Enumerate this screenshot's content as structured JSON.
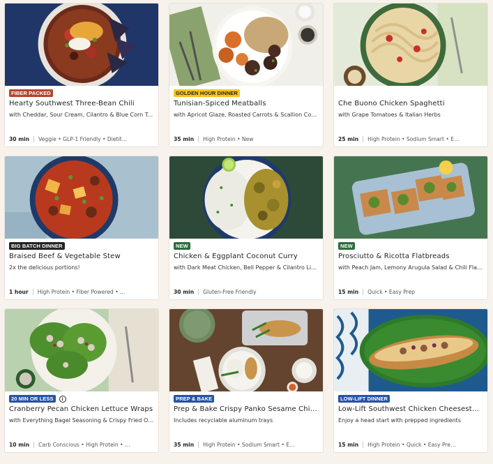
{
  "tag_colors": {
    "fiber_packed": {
      "bg": "#b5452d",
      "fg": "#ffffff"
    },
    "golden_hour": {
      "bg": "#f5c51a",
      "fg": "#242424"
    },
    "big_batch": {
      "bg": "#242424",
      "fg": "#ffffff"
    },
    "new": {
      "bg": "#2e6b3e",
      "fg": "#ffffff"
    },
    "twenty_min": {
      "bg": "#2553a6",
      "fg": "#ffffff"
    },
    "prep_bake": {
      "bg": "#2553a6",
      "fg": "#ffffff"
    },
    "low_lift": {
      "bg": "#2553a6",
      "fg": "#ffffff"
    }
  },
  "recipes": [
    {
      "tag": "FIBER PACKED",
      "title": "Hearty Southwest Three-Bean Chili",
      "subtitle": "with Cheddar, Sour Cream, Cilantro & Blue Corn Tor…",
      "time": "30 min",
      "attributes": "Veggie • GLP-1 Friendly • Dietit…",
      "image": "chili-bowl-image"
    },
    {
      "tag": "GOLDEN HOUR DINNER",
      "title": "Tunisian-Spiced Meatballs",
      "subtitle": "with Apricot Glaze, Roasted Carrots & Scallion Cous…",
      "time": "35 min",
      "attributes": "High Protein • New",
      "image": "meatballs-plate-image"
    },
    {
      "tag": "",
      "title": "Che Buono Chicken Spaghetti",
      "subtitle": "with Grape Tomatoes & Italian Herbs",
      "time": "25 min",
      "attributes": "High Protein • Sodium Smart • E…",
      "image": "spaghetti-bowl-image"
    },
    {
      "tag": "BIG BATCH DINNER",
      "title": "Braised Beef & Vegetable Stew",
      "subtitle": "2x the delicious portions!",
      "time": "1 hour",
      "attributes": "High Protein • Fiber Powered • …",
      "image": "stew-bowl-image"
    },
    {
      "tag": "NEW",
      "title": "Chicken & Eggplant Coconut Curry",
      "subtitle": "with Dark Meat Chicken, Bell Pepper & Cilantro Lim…",
      "time": "30 min",
      "attributes": "Gluten-Free Friendly",
      "image": "curry-bowl-image"
    },
    {
      "tag": "NEW",
      "title": "Prosciutto & Ricotta Flatbreads",
      "subtitle": "with Peach Jam, Lemony Arugula Salad & Chili Flakes",
      "time": "15 min",
      "attributes": "Quick • Easy Prep",
      "image": "flatbreads-tray-image"
    },
    {
      "tag": "20 MIN OR LESS",
      "title": "Cranberry Pecan Chicken Lettuce Wraps",
      "subtitle": "with Everything Bagel Seasoning & Crispy Fried Oni…",
      "time": "10 min",
      "attributes": "Carb Conscious • High Protein • …",
      "image": "lettuce-wraps-image",
      "info": "i"
    },
    {
      "tag": "PREP & BAKE",
      "title": "Prep & Bake Crispy Panko Sesame Chic…",
      "subtitle": "Includes recyclable aluminum trays",
      "time": "35 min",
      "attributes": "High Protein • Sodium Smart • E…",
      "image": "sesame-chicken-image"
    },
    {
      "tag": "LOW-LIFT DINNER",
      "title": "Low-Lift Southwest Chicken Cheesestea…",
      "subtitle": "Enjoy a head start with prepped ingredients",
      "time": "15 min",
      "attributes": "High Protein • Quick • Easy Pre…",
      "image": "cheesesteak-image"
    }
  ]
}
